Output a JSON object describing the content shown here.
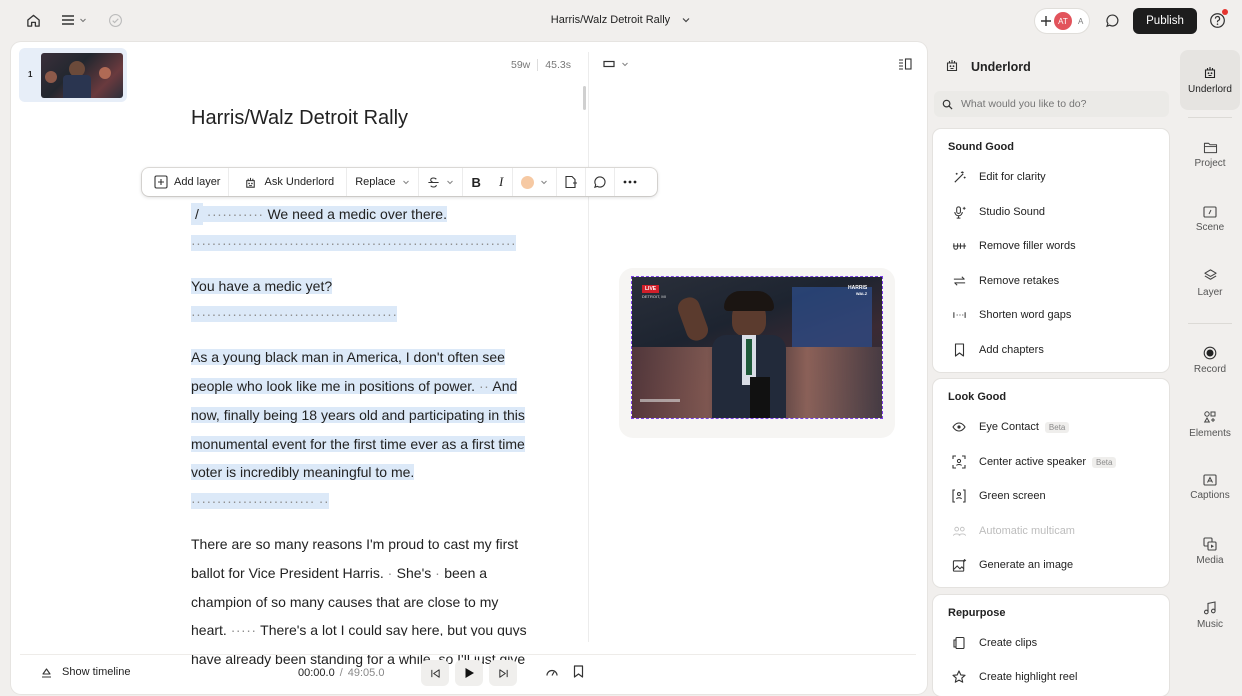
{
  "topbar": {
    "title": "Harris/Walz Detroit Rally",
    "avatar_initials": "AT",
    "avatar_letter": "A",
    "publish_label": "Publish"
  },
  "editor": {
    "scene_number": "1",
    "doc_heading": "Harris/Walz Detroit Rally",
    "word_count": "59w",
    "duration": "45.3s",
    "toolbar": {
      "add_layer": "Add layer",
      "ask_underlord": "Ask Underlord",
      "replace": "Replace",
      "bold": "B",
      "italic": "I"
    },
    "script": {
      "p1_mark": "/",
      "p1_dots_a": "···········",
      "p1_text": "We need a medic over there.",
      "p1_dots_b": "·······························································",
      "p2_text": "You have a medic yet?",
      "p2_dots": "········································",
      "p3_text_a": "As a young black man in America, I don't often see people who look like me in positions of power.",
      "p3_dots_a": "··",
      "p3_text_b": "And now, finally being 18 years old and participating in this monumental event for the first time ever as a first time voter is incredibly meaningful to me.",
      "p3_dots_b": "························",
      "p3_dots_c": "··",
      "p4_text_a": "There are so many reasons I'm proud to cast my first ballot for Vice President Harris.",
      "p4_dot_a": "·",
      "p4_text_b": "She's",
      "p4_dot_b": "·",
      "p4_text_c": "been a champion of so many causes that are close to my heart.",
      "p4_dots_c": "·····",
      "p4_text_d": "There's a lot I could say here, but you guys have already been standing for a while, so I'll just give"
    },
    "preview": {
      "live_badge": "LIVE",
      "location": "DETROIT, MI",
      "brand_top": "HARRIS",
      "brand_bottom": "WALZ"
    },
    "footer": {
      "show_timeline": "Show timeline",
      "time_current": "00:00.0",
      "time_sep": "/",
      "time_total": "49:05.0"
    }
  },
  "underlord": {
    "title": "Underlord",
    "search_placeholder": "What would you like to do?",
    "sections": [
      {
        "title": "Sound Good",
        "items": [
          {
            "label": "Edit for clarity",
            "icon": "wand-icon"
          },
          {
            "label": "Studio Sound",
            "icon": "mic-sparkle-icon"
          },
          {
            "label": "Remove filler words",
            "icon": "strike-uh-icon"
          },
          {
            "label": "Remove retakes",
            "icon": "retake-arrows-icon"
          },
          {
            "label": "Shorten word gaps",
            "icon": "gap-icon"
          },
          {
            "label": "Add chapters",
            "icon": "bookmark-icon"
          }
        ]
      },
      {
        "title": "Look Good",
        "items": [
          {
            "label": "Eye Contact",
            "badge": "Beta",
            "icon": "eye-icon"
          },
          {
            "label": "Center active speaker",
            "badge": "Beta",
            "icon": "speaker-frame-icon"
          },
          {
            "label": "Green screen",
            "icon": "green-screen-icon"
          },
          {
            "label": "Automatic multicam",
            "icon": "multicam-icon",
            "disabled": true
          },
          {
            "label": "Generate an image",
            "icon": "image-sparkle-icon"
          }
        ]
      },
      {
        "title": "Repurpose",
        "items": [
          {
            "label": "Create clips",
            "icon": "clips-icon"
          },
          {
            "label": "Create highlight reel",
            "icon": "star-icon"
          }
        ]
      }
    ]
  },
  "sidebar": {
    "items": [
      "Underlord",
      "Project",
      "Scene",
      "Layer",
      "Record",
      "Elements",
      "Captions",
      "Media",
      "Music"
    ]
  },
  "colors": {
    "highlight": "#dce9f8",
    "publish_bg": "#1d1d1d",
    "avatar_red": "#e2535b",
    "live_red": "#d21f2a",
    "notification_dot": "#e5342f"
  }
}
